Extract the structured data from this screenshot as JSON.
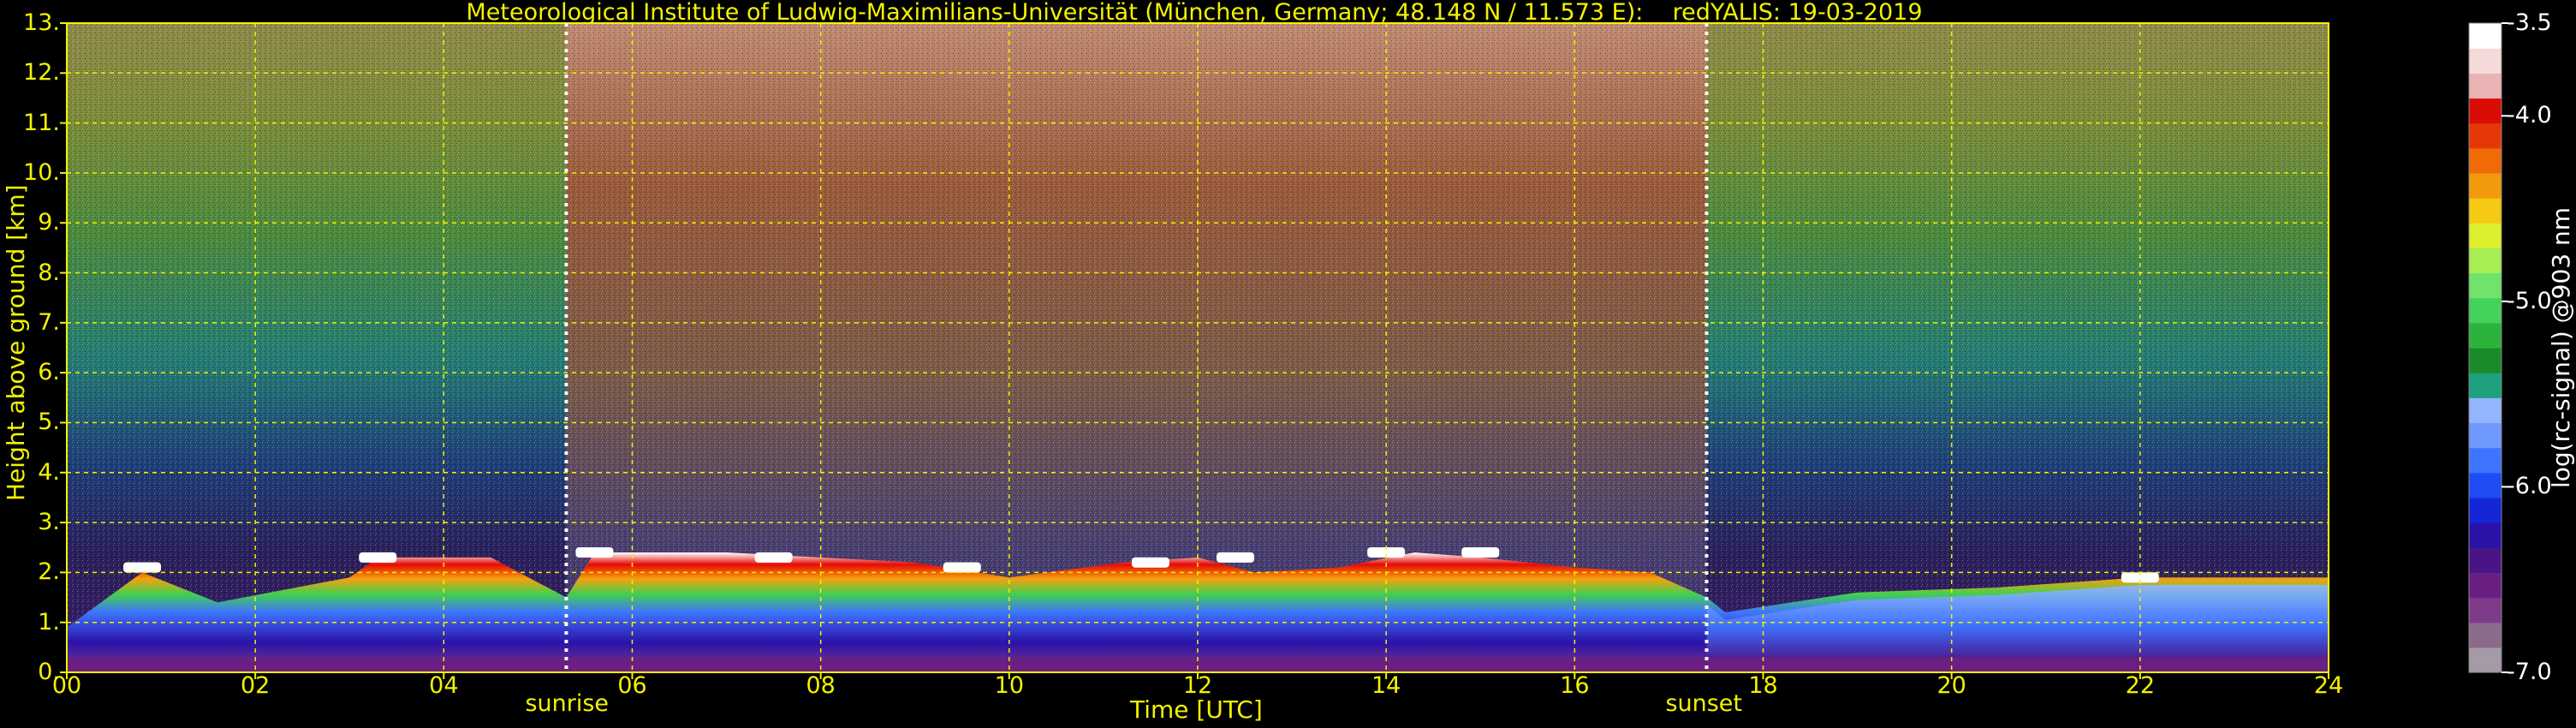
{
  "chart_data": {
    "type": "heatmap",
    "title": "Meteorological Institute of Ludwig-Maximilians-Universität (München, Germany; 48.148 N / 11.573 E):    redYALIS: 19-03-2019",
    "xlabel": "Time [UTC]",
    "ylabel": "Height above ground [km]",
    "xlim": [
      0,
      24
    ],
    "ylim": [
      0,
      13
    ],
    "x_ticks": [
      "00",
      "02",
      "04",
      "06",
      "08",
      "10",
      "12",
      "14",
      "16",
      "18",
      "20",
      "22",
      "24"
    ],
    "y_ticks": [
      "0.",
      "1.",
      "2.",
      "3.",
      "4.",
      "5.",
      "6.",
      "7.",
      "8.",
      "9.",
      "10.",
      "11.",
      "12.",
      "13."
    ],
    "grid": true,
    "annotations": [
      {
        "label": "sunrise",
        "x": 5.3
      },
      {
        "label": "sunset",
        "x": 17.4
      }
    ],
    "colorbar": {
      "label": "log(rc-signal) @903 nm",
      "range": [
        -7.0,
        -3.5
      ],
      "ticks": [
        "-3.5",
        "-4.0",
        "-5.0",
        "-6.0",
        "-7.0"
      ],
      "colors": [
        "#a59aa6",
        "#8a6b8c",
        "#7d3b8a",
        "#6a1f82",
        "#4b1486",
        "#2a12a8",
        "#1526d8",
        "#1e4cf5",
        "#3f74ff",
        "#6f99ff",
        "#93b6ff",
        "#1fa07e",
        "#1b8a2a",
        "#2cb33c",
        "#43d35a",
        "#6fe36a",
        "#a6ee52",
        "#dcee2c",
        "#f5c914",
        "#f39a0c",
        "#f06a08",
        "#e63806",
        "#d90d05",
        "#eab3b3",
        "#f6dada",
        "#ffffff"
      ]
    },
    "boundary_layer_top_km": [
      [
        0.0,
        0.9
      ],
      [
        0.8,
        2.0
      ],
      [
        1.6,
        1.4
      ],
      [
        3.0,
        1.9
      ],
      [
        3.3,
        2.3
      ],
      [
        4.5,
        2.3
      ],
      [
        5.3,
        1.5
      ],
      [
        5.6,
        2.4
      ],
      [
        7.0,
        2.4
      ],
      [
        8.0,
        2.3
      ],
      [
        9.0,
        2.2
      ],
      [
        10.0,
        1.9
      ],
      [
        11.2,
        2.2
      ],
      [
        12.0,
        2.3
      ],
      [
        12.6,
        2.0
      ],
      [
        13.5,
        2.1
      ],
      [
        14.3,
        2.4
      ],
      [
        15.0,
        2.3
      ],
      [
        16.0,
        2.1
      ],
      [
        16.8,
        2.0
      ],
      [
        17.4,
        1.5
      ],
      [
        17.6,
        1.2
      ],
      [
        19.0,
        1.6
      ],
      [
        20.5,
        1.7
      ],
      [
        22.0,
        1.9
      ],
      [
        24.0,
        1.9
      ]
    ],
    "cloud_top_km": [
      [
        0.8,
        2.1
      ],
      [
        3.3,
        2.3
      ],
      [
        5.6,
        2.4
      ],
      [
        7.5,
        2.3
      ],
      [
        9.5,
        2.1
      ],
      [
        11.5,
        2.2
      ],
      [
        12.4,
        2.3
      ],
      [
        14.0,
        2.4
      ],
      [
        15.0,
        2.4
      ],
      [
        22.0,
        1.9
      ]
    ]
  }
}
